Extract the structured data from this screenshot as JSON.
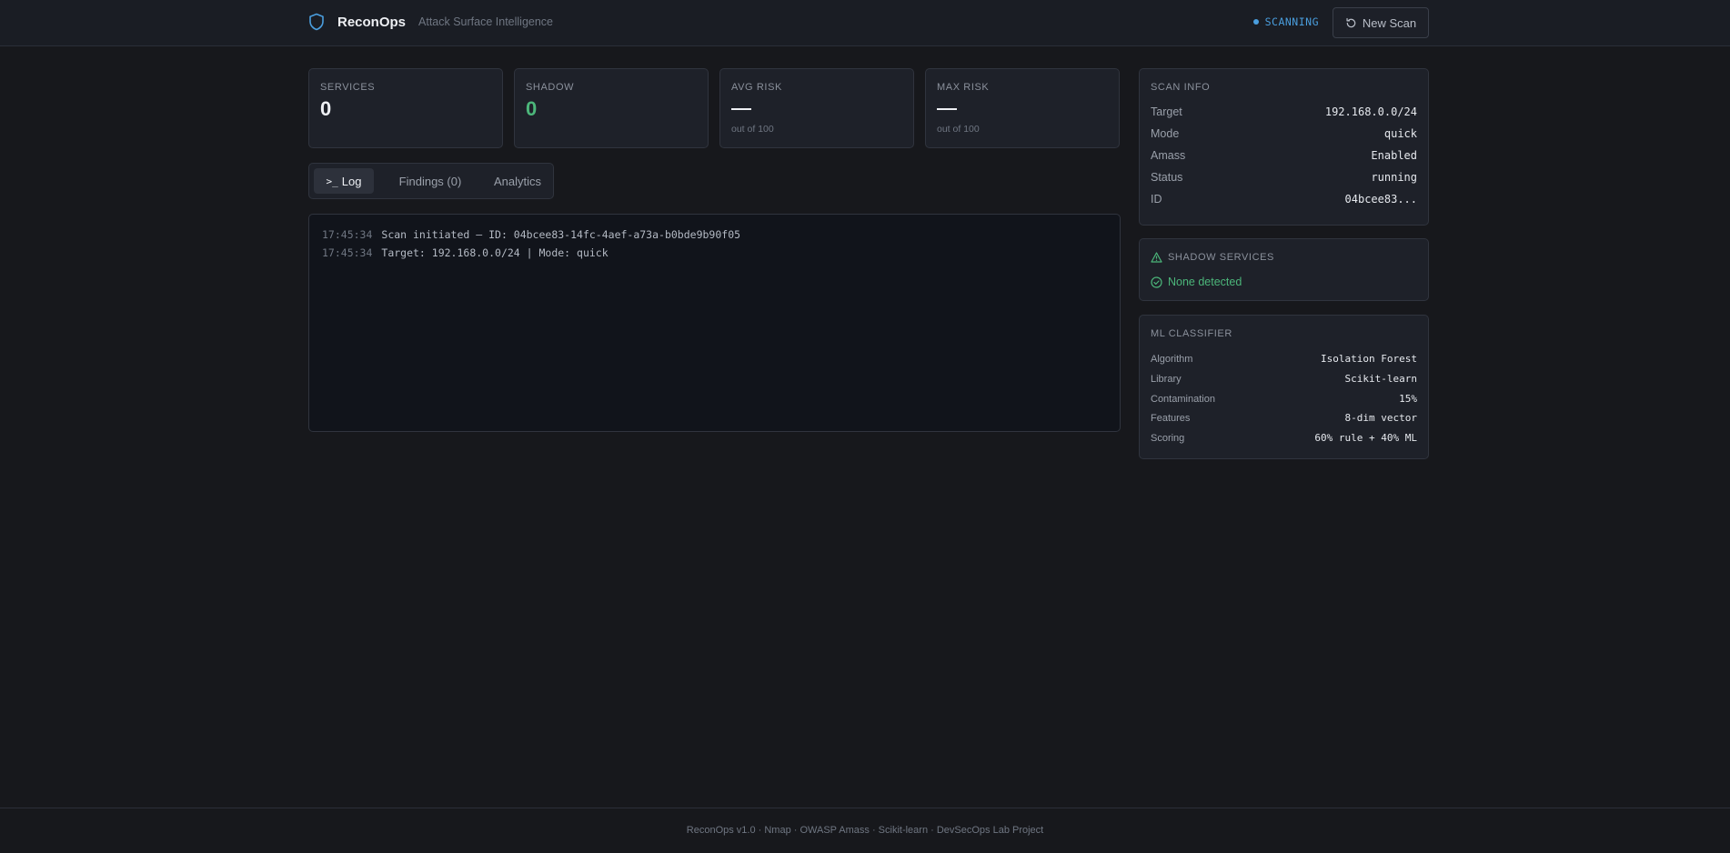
{
  "header": {
    "app_name": "ReconOps",
    "subtitle": "Attack Surface Intelligence",
    "status": "SCANNING",
    "new_scan_label": "New Scan",
    "accent_color": "#4a9ede"
  },
  "stats": [
    {
      "label": "SERVICES",
      "value": "0"
    },
    {
      "label": "SHADOW",
      "value": "0"
    },
    {
      "label": "AVG RISK",
      "sub": "out of 100"
    },
    {
      "label": "MAX RISK",
      "sub": "out of 100"
    }
  ],
  "tabs": [
    {
      "label": "Log",
      "active": true
    },
    {
      "label": "Findings (0)",
      "active": false
    },
    {
      "label": "Analytics",
      "active": false
    }
  ],
  "log": [
    {
      "time": "17:45:34",
      "message": "Scan initiated — ID: 04bcee83-14fc-4aef-a73a-b0bde9b90f05"
    },
    {
      "time": "17:45:34",
      "message": "Target: 192.168.0.0/24 | Mode: quick"
    }
  ],
  "scan_info": {
    "title": "SCAN INFO",
    "rows": [
      {
        "key": "Target",
        "value": "192.168.0.0/24"
      },
      {
        "key": "Mode",
        "value": "quick"
      },
      {
        "key": "Amass",
        "value": "Enabled"
      },
      {
        "key": "Status",
        "value": "running"
      },
      {
        "key": "ID",
        "value": "04bcee83..."
      }
    ]
  },
  "shadow_services": {
    "title": "SHADOW SERVICES",
    "status": "None detected"
  },
  "ml_classifier": {
    "title": "ML CLASSIFIER",
    "rows": [
      {
        "key": "Algorithm",
        "value": "Isolation Forest"
      },
      {
        "key": "Library",
        "value": "Scikit-learn"
      },
      {
        "key": "Contamination",
        "value": "15%"
      },
      {
        "key": "Features",
        "value": "8-dim vector"
      },
      {
        "key": "Scoring",
        "value": "60% rule + 40% ML"
      }
    ]
  },
  "footer": {
    "text": "ReconOps v1.0 · Nmap · OWASP Amass · Scikit-learn · DevSecOps Lab Project"
  }
}
